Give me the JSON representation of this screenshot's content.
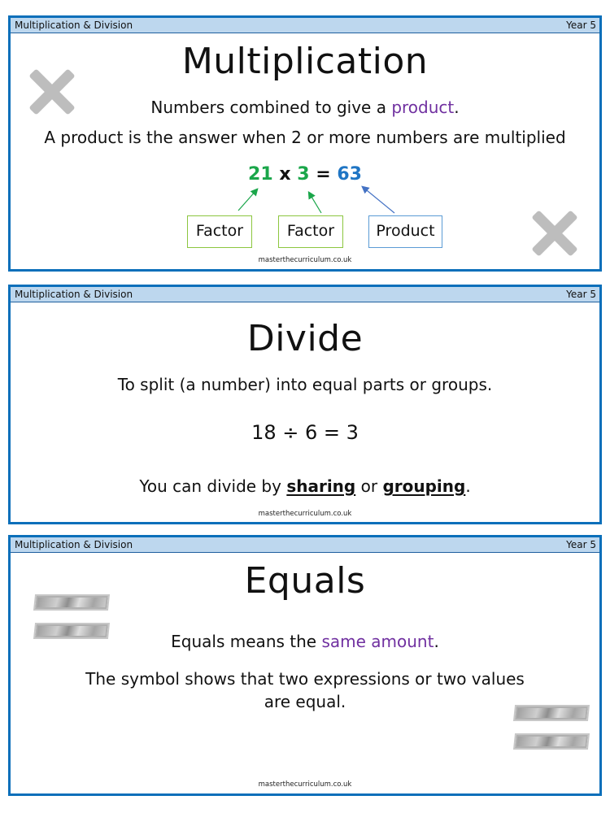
{
  "cards": [
    {
      "header": {
        "topic": "Multiplication & Division",
        "year": "Year 5"
      },
      "title": "Multiplication",
      "line1": {
        "before": "Numbers combined to give a ",
        "highlight": "product",
        "after": "."
      },
      "line2": "A product is the answer when 2 or more numbers are multiplied",
      "equation": {
        "factor1": "21",
        "times": "x",
        "factor2": "3",
        "equals": "=",
        "product": "63"
      },
      "labels": [
        "Factor",
        "Factor",
        "Product"
      ],
      "icons": [
        "multiply-cross-icon",
        "multiply-cross-icon"
      ],
      "footer": "masterthecurriculum.co.uk"
    },
    {
      "header": {
        "topic": "Multiplication & Division",
        "year": "Year 5"
      },
      "title": "Divide",
      "line1": "To split (a number) into equal parts or groups.",
      "equation": "18 ÷ 6 = 3",
      "line3": {
        "before": "You can divide by ",
        "word1": "sharing",
        "middle": " or ",
        "word2": "grouping",
        "after": "."
      },
      "footer": "masterthecurriculum.co.uk"
    },
    {
      "header": {
        "topic": "Multiplication & Division",
        "year": "Year 5"
      },
      "title": "Equals",
      "line1": {
        "before": "Equals means the ",
        "highlight": "same amount",
        "after": "."
      },
      "line2a": "The symbol shows that two expressions or two values",
      "line2b": "are equal.",
      "icons": [
        "equals-sign-icon",
        "equals-sign-icon"
      ],
      "footer": "masterthecurriculum.co.uk"
    }
  ],
  "colors": {
    "border": "#0b6fba",
    "header_bg": "#bdd7ee",
    "highlight_purple": "#7030a0",
    "factor_green": "#1aa64a",
    "product_blue": "#1f75c4",
    "factor_box_border": "#8cc63f",
    "product_box_border": "#5b9bd5",
    "icon_grey": "#bdbdbd"
  }
}
